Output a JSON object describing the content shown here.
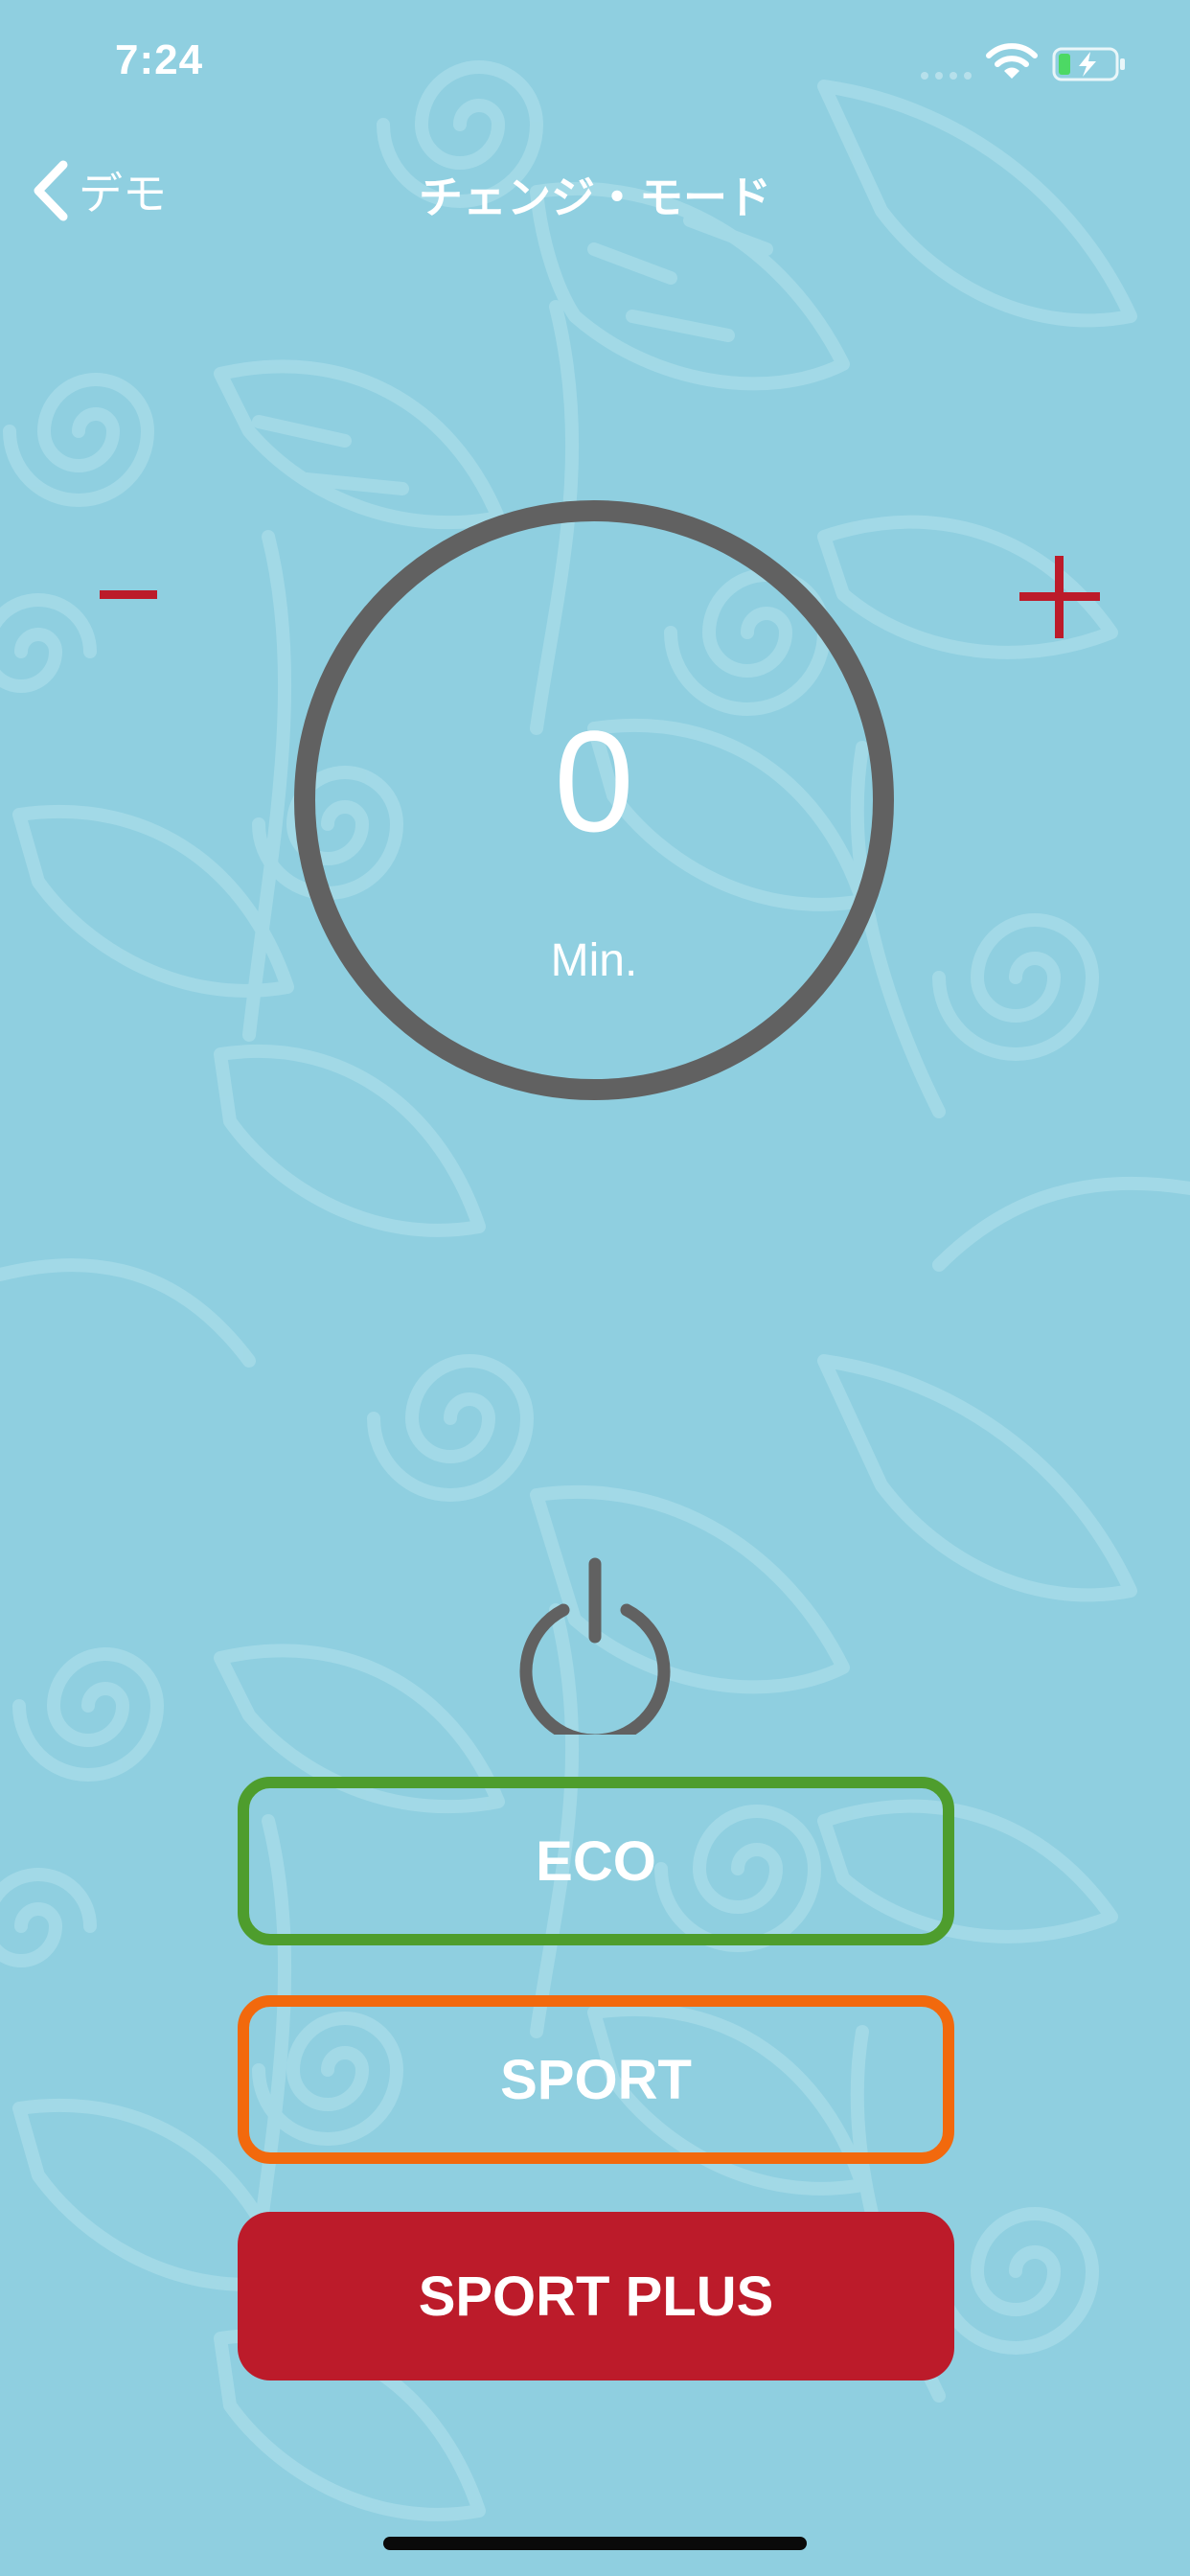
{
  "status_bar": {
    "time": "7:24",
    "wifi_icon": "wifi-icon",
    "battery_icon": "battery-charging-icon"
  },
  "nav": {
    "back_label": "デモ",
    "back_icon": "chevron-left-icon",
    "title": "チェンジ・モード"
  },
  "timer": {
    "minus_symbol": "−",
    "plus_symbol": "+",
    "value": "0",
    "unit": "Min."
  },
  "power": {
    "icon": "power-icon"
  },
  "modes": {
    "eco": "ECO",
    "sport": "SPORT",
    "sport_plus": "SPORT PLUS"
  },
  "colors": {
    "background": "#8fcfe0",
    "accent_red": "#bc1b2a",
    "eco_green": "#4e9d2d",
    "sport_orange": "#f2690d",
    "ring_gray": "#616161"
  }
}
